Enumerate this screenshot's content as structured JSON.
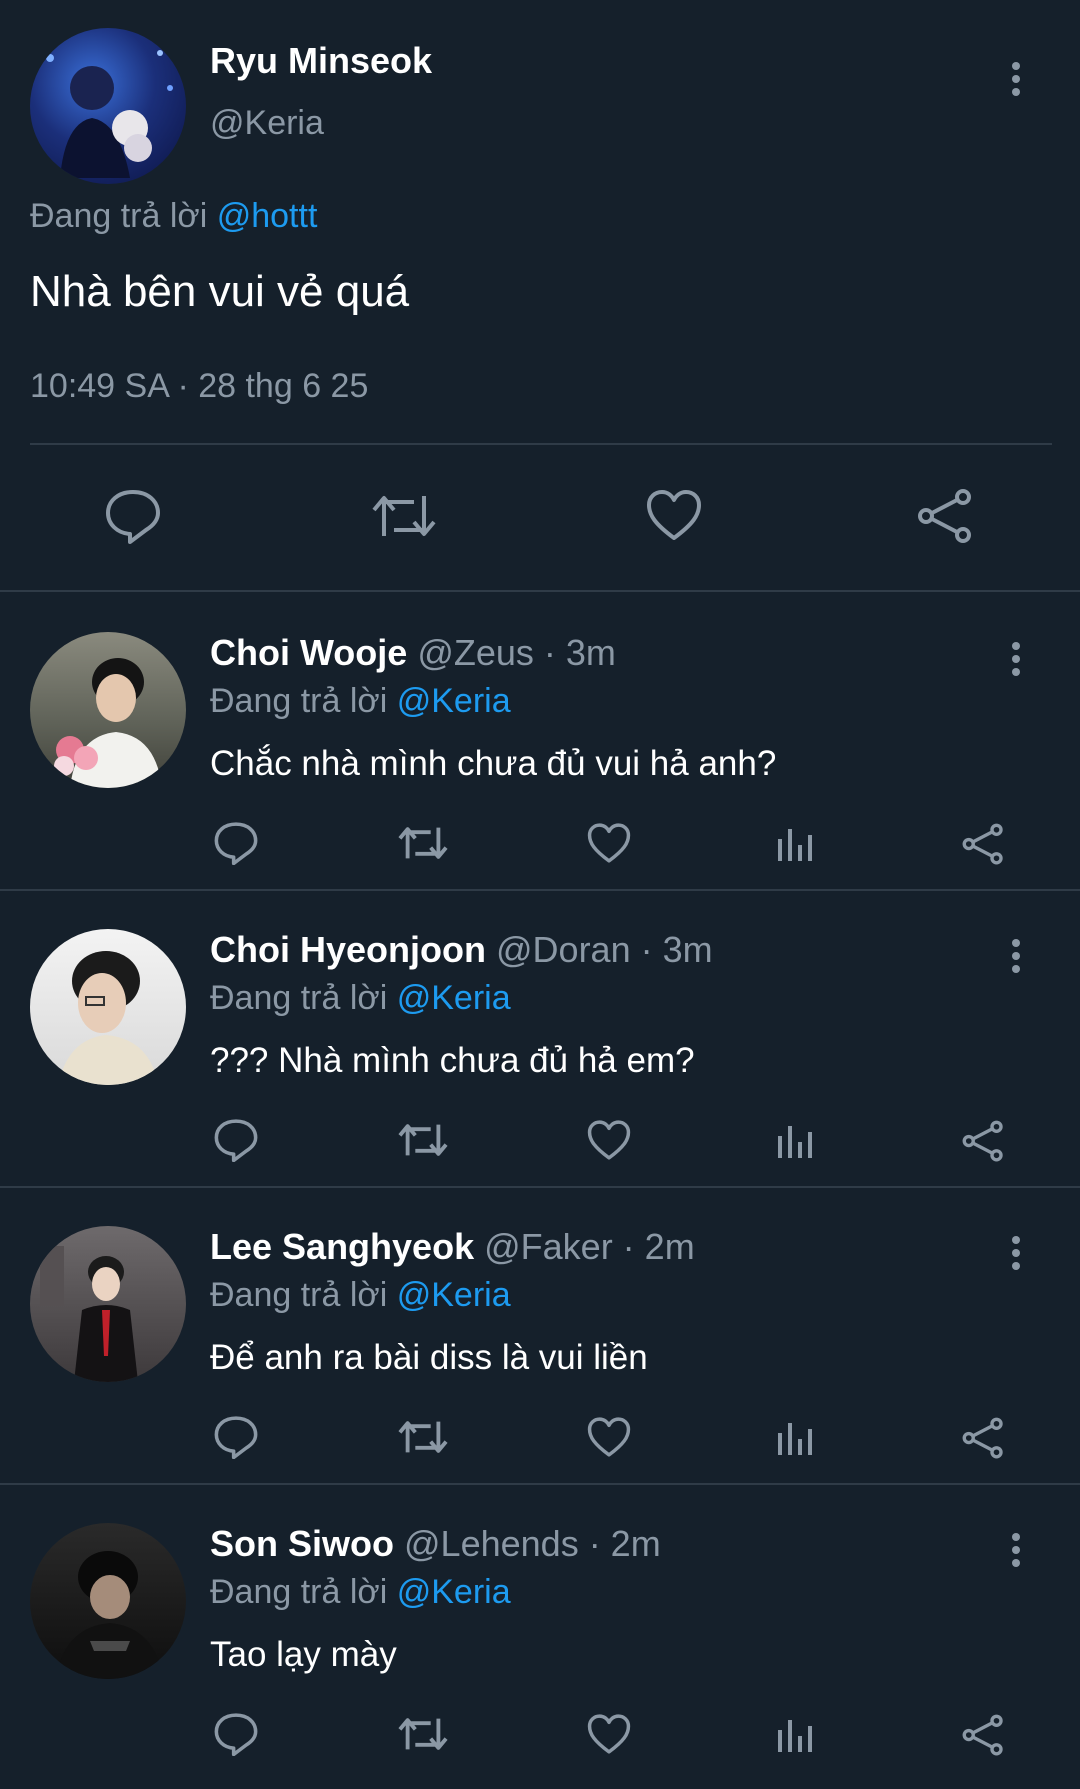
{
  "main_tweet": {
    "name": "Ryu Minseok",
    "handle": "@Keria",
    "reply_prefix": "Đang trả lời",
    "reply_mention": "@hottt",
    "text": "Nhà bên vui vẻ quá",
    "timestamp": "10:49 SA · 28 thg 6 25"
  },
  "replies": [
    {
      "name": "Choi Wooje",
      "meta": "@Zeus · 3m",
      "reply_prefix": "Đang trả lời",
      "reply_mention": "@Keria",
      "text": "Chắc nhà mình chưa đủ vui hả anh?"
    },
    {
      "name": "Choi Hyeonjoon",
      "meta": "@Doran · 3m",
      "reply_prefix": "Đang trả lời",
      "reply_mention": "@Keria",
      "text": "??? Nhà mình chưa đủ hả em?"
    },
    {
      "name": "Lee Sanghyeok",
      "meta": "@Faker · 2m",
      "reply_prefix": "Đang trả lời",
      "reply_mention": "@Keria",
      "text": "Để anh ra bài diss là vui liền"
    },
    {
      "name": "Son Siwoo",
      "meta": "@Lehends · 2m",
      "reply_prefix": "Đang trả lời",
      "reply_mention": "@Keria",
      "text": "Tao lạy mày"
    }
  ],
  "colors": {
    "background": "#15202b",
    "secondary_text": "#8b98a5",
    "mention": "#1d9bf0",
    "divider": "#2f3b47"
  },
  "icons": [
    "more-icon",
    "reply-icon",
    "retweet-icon",
    "like-icon",
    "views-icon",
    "share-icon"
  ]
}
